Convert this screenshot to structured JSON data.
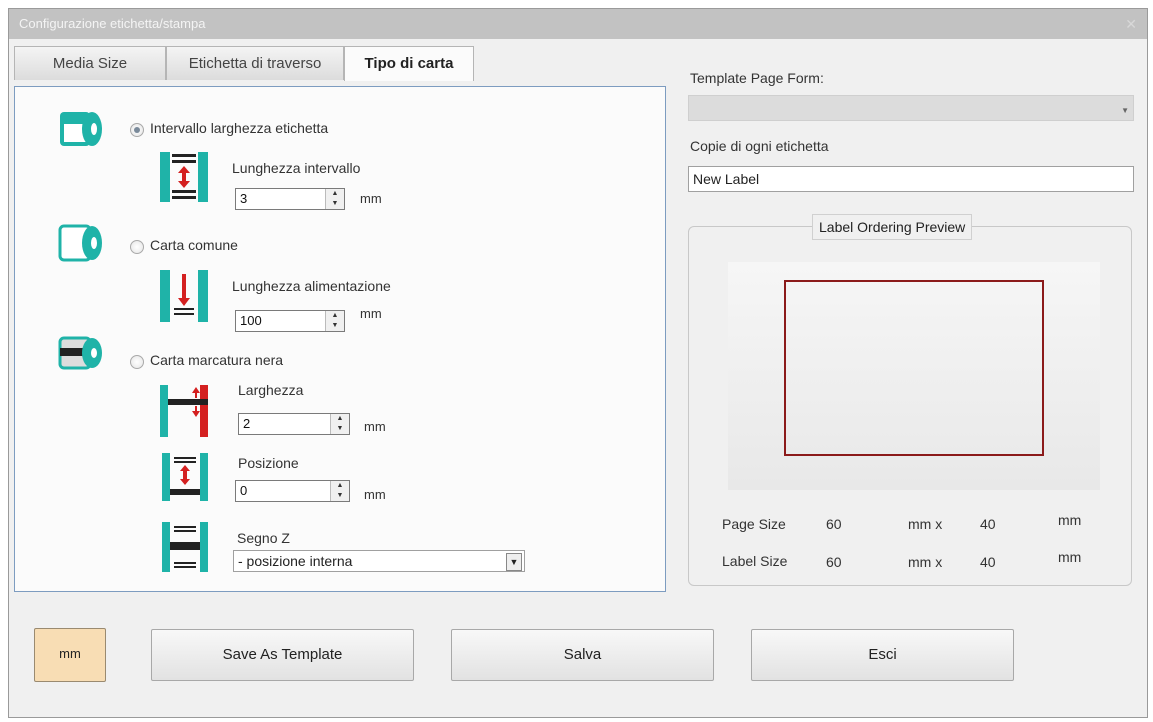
{
  "window": {
    "title": "Configurazione etichetta/stampa",
    "close_glyph": "✕"
  },
  "tabs": [
    {
      "label": "Media Size"
    },
    {
      "label": "Etichetta di traverso"
    },
    {
      "label": "Tipo di carta"
    }
  ],
  "paper_type": {
    "gap": {
      "radio_label": "Intervallo larghezza etichetta",
      "length_label": "Lunghezza intervallo",
      "length_value": "3",
      "unit": "mm"
    },
    "plain": {
      "radio_label": "Carta comune",
      "feed_label": "Lunghezza alimentazione",
      "feed_value": "100",
      "unit": "mm"
    },
    "black_mark": {
      "radio_label": "Carta marcatura nera",
      "width_label": "Larghezza",
      "width_value": "2",
      "width_unit": "mm",
      "position_label": "Posizione",
      "position_value": "0",
      "position_unit": "mm",
      "z_label": "Segno Z",
      "z_value": "- posizione interna"
    },
    "selected": "gap"
  },
  "right": {
    "template_label": "Template Page Form:",
    "template_value": "",
    "copies_label": "Copie di ogni etichetta",
    "copies_value": "New Label",
    "preview_title": "Label Ordering Preview",
    "page_size_label": "Page Size",
    "page_width": "60",
    "page_sep": "mm x",
    "page_height": "40",
    "page_unit": "mm",
    "label_size_label": "Label Size",
    "label_width": "60",
    "label_sep": "mm x",
    "label_height": "40",
    "label_unit": "mm"
  },
  "buttons": {
    "unit": "mm",
    "save_template": "Save As Template",
    "save": "Salva",
    "exit": "Esci"
  },
  "colors": {
    "accent_teal": "#1fb3a8",
    "mark_red": "#d42020",
    "preview_border": "#8b1a1a",
    "unit_button": "#f8ddb4"
  }
}
